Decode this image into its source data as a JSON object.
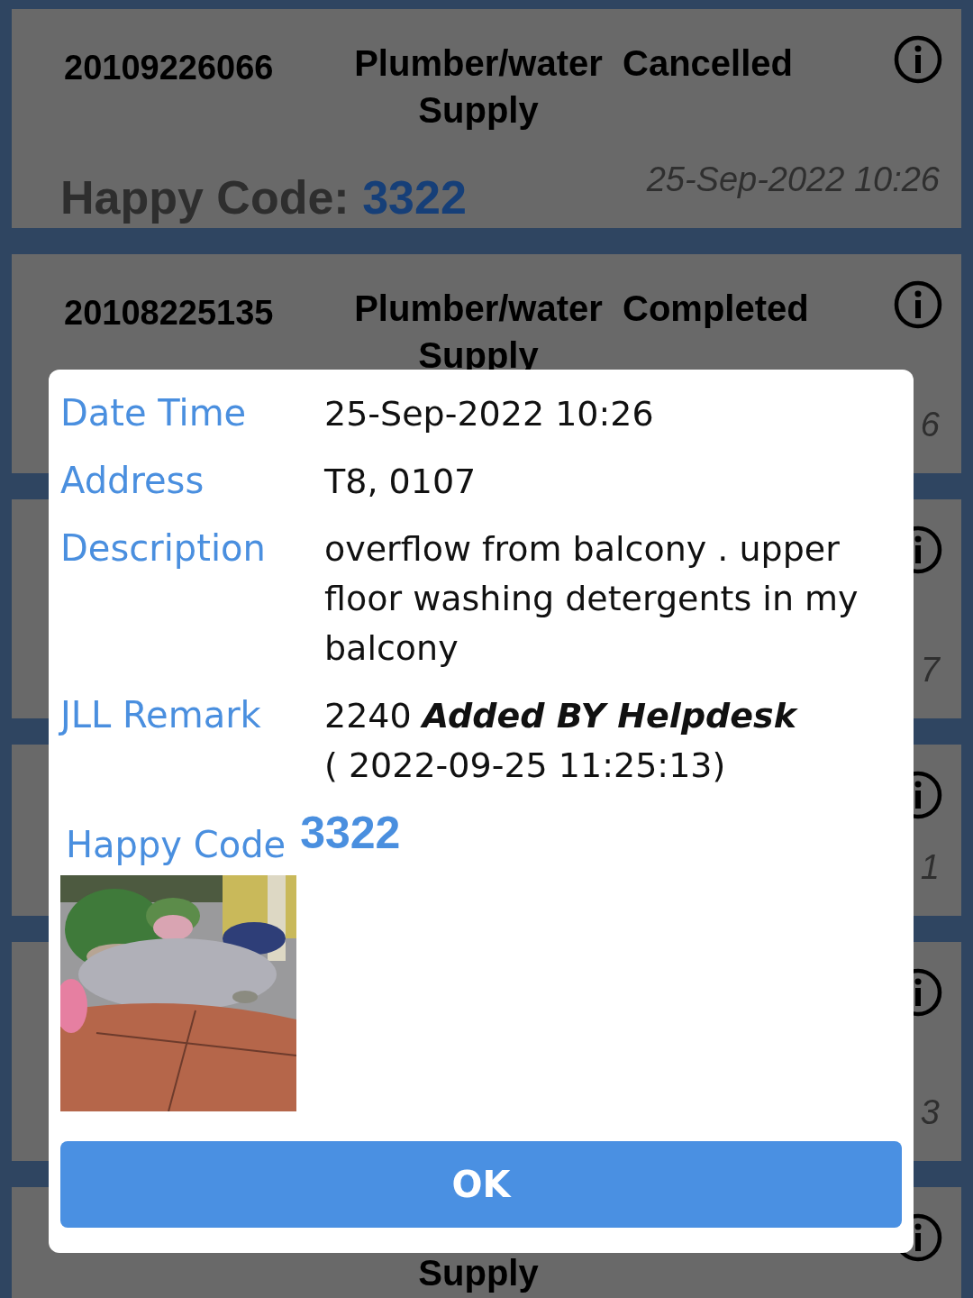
{
  "tickets": [
    {
      "id": "20109226066",
      "service": "Plumber/water Supply",
      "status": "Cancelled",
      "happy_code_label": "Happy Code:",
      "happy_code": "3322",
      "date": "25-Sep-2022 10:26"
    },
    {
      "id": "20108225135",
      "service": "Plumber/water Supply",
      "status": "Completed",
      "date": "6"
    },
    {
      "date": "7"
    },
    {
      "date": "1"
    },
    {
      "date": "3"
    },
    {
      "service": "Supply"
    }
  ],
  "dialog": {
    "rows": [
      {
        "label": "Date Time",
        "value": "25-Sep-2022 10:26"
      },
      {
        "label": "Address",
        "value": "T8, 0107"
      },
      {
        "label": "Description",
        "value": "overflow from balcony . upper floor washing detergents in my balcony"
      },
      {
        "label": "JLL Remark",
        "value": "2240 *Added BY Helpdesk*\n( 2022-09-25 11:25:13)"
      }
    ],
    "happy_code_label": "Happy Code",
    "happy_code": "3322",
    "ok_button": "OK"
  }
}
